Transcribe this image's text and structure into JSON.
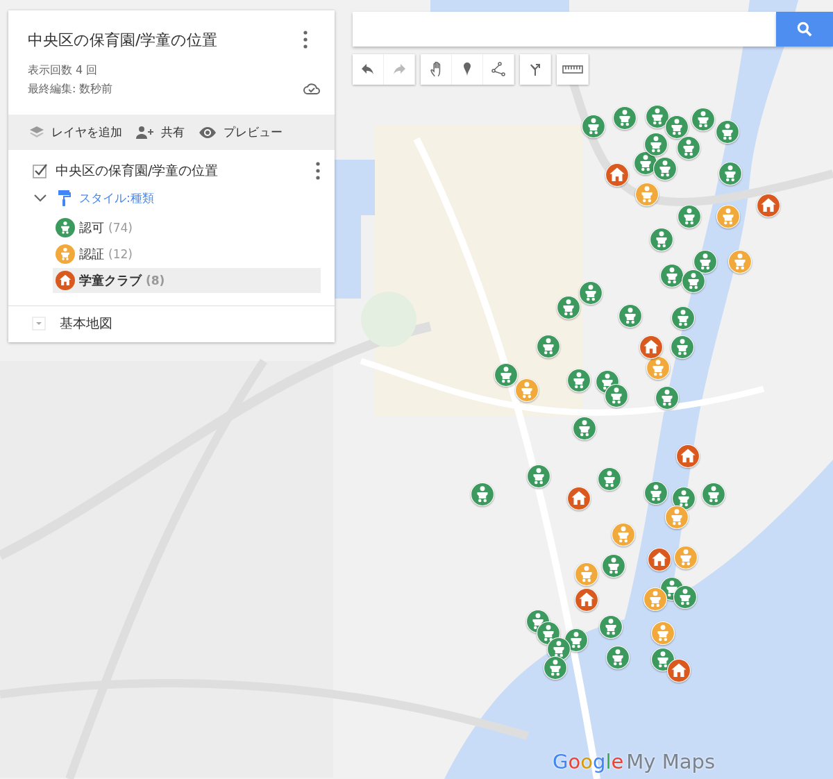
{
  "panel": {
    "title": "中央区の保育園/学童の位置",
    "views": "表示回数 4 回",
    "last_edited": "最終編集: 数秒前"
  },
  "actions": [
    {
      "kind": "layers",
      "label": "レイヤを追加"
    },
    {
      "kind": "share",
      "label": "共有"
    },
    {
      "kind": "preview",
      "label": "プレビュー"
    }
  ],
  "layer": {
    "name": "中央区の保育園/学童の位置",
    "checked": true,
    "expanded": true,
    "style_label": "スタイル:種類",
    "items": [
      {
        "label": "認可",
        "count": "(74)",
        "color": "#3d9a5e",
        "kind": "baby",
        "selected": false
      },
      {
        "label": "認証",
        "count": "(12)",
        "color": "#f2a93b",
        "kind": "baby",
        "selected": false
      },
      {
        "label": "学童クラブ",
        "count": "(8)",
        "color": "#d9591f",
        "kind": "house",
        "selected": true
      }
    ]
  },
  "base_map": {
    "label": "基本地図"
  },
  "tools": [
    {
      "kind": "undo",
      "disabled": false
    },
    {
      "kind": "redo",
      "disabled": true
    },
    {
      "kind": "hand",
      "disabled": false
    },
    {
      "kind": "marker",
      "disabled": false
    },
    {
      "kind": "line",
      "disabled": false
    },
    {
      "kind": "route",
      "disabled": false
    },
    {
      "kind": "ruler",
      "disabled": false
    }
  ],
  "logo": {
    "brand": "Google",
    "product": "My Maps"
  }
}
